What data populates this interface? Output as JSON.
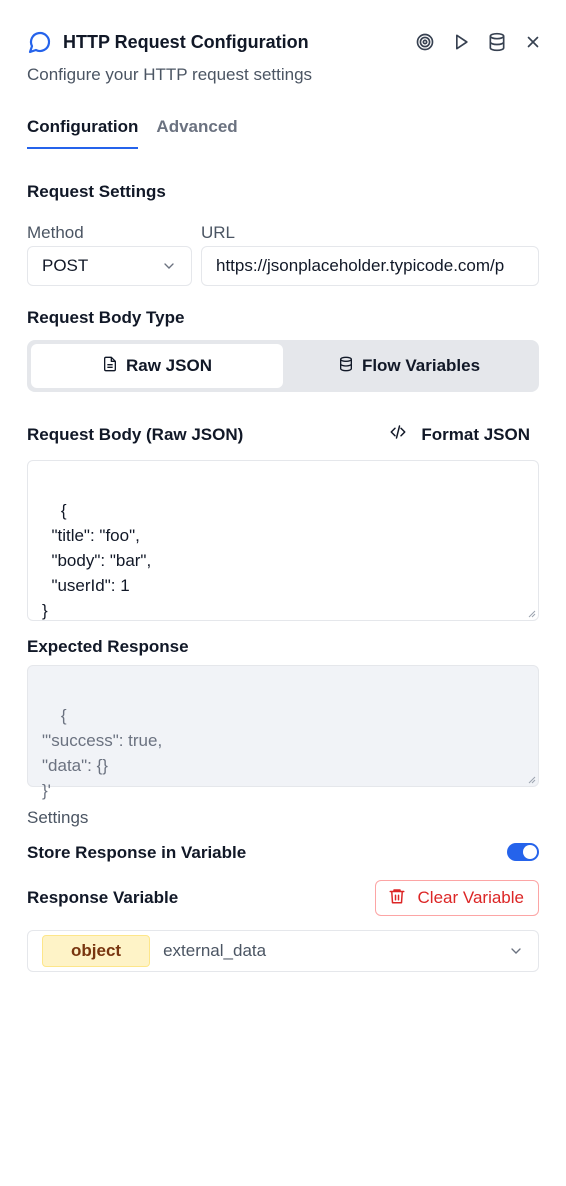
{
  "header": {
    "title": "HTTP Request Configuration",
    "subtitle": "Configure your HTTP request settings",
    "icons": [
      "message-circle-icon",
      "target-icon",
      "play-icon",
      "database-icon",
      "close-icon"
    ]
  },
  "tabs": [
    {
      "label": "Configuration",
      "active": true
    },
    {
      "label": "Advanced",
      "active": false
    }
  ],
  "request_settings": {
    "title": "Request Settings",
    "method_label": "Method",
    "method_value": "POST",
    "url_label": "URL",
    "url_value": "https://jsonplaceholder.typicode.com/p"
  },
  "body_type": {
    "title": "Request Body Type",
    "options": [
      {
        "label": "Raw JSON",
        "icon": "file-text-icon",
        "active": true
      },
      {
        "label": "Flow Variables",
        "icon": "database-icon",
        "active": false
      }
    ]
  },
  "request_body": {
    "title": "Request Body (Raw JSON)",
    "format_label": "Format JSON",
    "content": "{\n  \"title\": \"foo\",\n  \"body\": \"bar\",\n  \"userId\": 1\n}"
  },
  "expected_response": {
    "title": "Expected Response",
    "content": "{\n\"'success\": true,\n\"data\": {}\n}'"
  },
  "settings": {
    "title": "Settings",
    "store_label": "Store Response in Variable",
    "store_enabled": true,
    "response_variable_label": "Response Variable",
    "clear_label": "Clear Variable",
    "variable_type": "object",
    "variable_name": "external_data"
  },
  "colors": {
    "accent": "#2563eb",
    "danger": "#dc2626",
    "badge_bg": "#fef3c7"
  }
}
